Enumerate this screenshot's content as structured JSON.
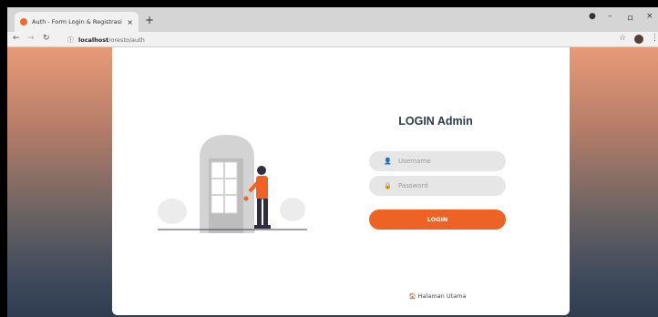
{
  "browser": {
    "tab_title": "Auth - Form Login & Registrasi",
    "tab_close": "×",
    "new_tab": "+",
    "url_host": "localhost",
    "url_path": "/oresto/auth",
    "controls": {
      "minimize": "–",
      "restore": "ロ",
      "close": "×"
    }
  },
  "login": {
    "title": "LOGIN Admin",
    "username_placeholder": "Username",
    "password_placeholder": "Password",
    "button_label": "LOGIN",
    "home_link": "Halaman Utama"
  },
  "colors": {
    "accent": "#ee6324",
    "title": "#2d3a4a",
    "input_bg": "#e6e6e6",
    "gradient_top": "#e89a77",
    "gradient_bottom": "#2f3c50"
  },
  "icons": {
    "user": "user-icon",
    "lock": "lock-icon",
    "home": "home-icon"
  }
}
